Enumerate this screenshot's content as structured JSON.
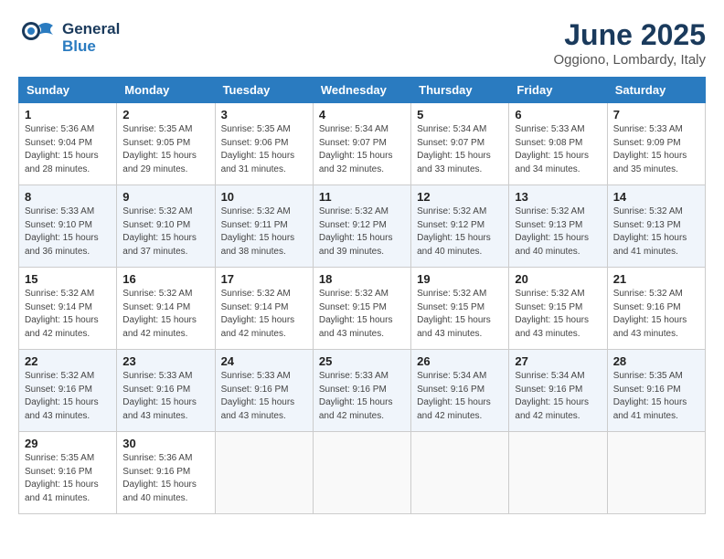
{
  "header": {
    "logo_general": "General",
    "logo_blue": "Blue",
    "title": "June 2025",
    "subtitle": "Oggiono, Lombardy, Italy"
  },
  "weekdays": [
    "Sunday",
    "Monday",
    "Tuesday",
    "Wednesday",
    "Thursday",
    "Friday",
    "Saturday"
  ],
  "weeks": [
    [
      {
        "day": "1",
        "info": "Sunrise: 5:36 AM\nSunset: 9:04 PM\nDaylight: 15 hours\nand 28 minutes."
      },
      {
        "day": "2",
        "info": "Sunrise: 5:35 AM\nSunset: 9:05 PM\nDaylight: 15 hours\nand 29 minutes."
      },
      {
        "day": "3",
        "info": "Sunrise: 5:35 AM\nSunset: 9:06 PM\nDaylight: 15 hours\nand 31 minutes."
      },
      {
        "day": "4",
        "info": "Sunrise: 5:34 AM\nSunset: 9:07 PM\nDaylight: 15 hours\nand 32 minutes."
      },
      {
        "day": "5",
        "info": "Sunrise: 5:34 AM\nSunset: 9:07 PM\nDaylight: 15 hours\nand 33 minutes."
      },
      {
        "day": "6",
        "info": "Sunrise: 5:33 AM\nSunset: 9:08 PM\nDaylight: 15 hours\nand 34 minutes."
      },
      {
        "day": "7",
        "info": "Sunrise: 5:33 AM\nSunset: 9:09 PM\nDaylight: 15 hours\nand 35 minutes."
      }
    ],
    [
      {
        "day": "8",
        "info": "Sunrise: 5:33 AM\nSunset: 9:10 PM\nDaylight: 15 hours\nand 36 minutes."
      },
      {
        "day": "9",
        "info": "Sunrise: 5:32 AM\nSunset: 9:10 PM\nDaylight: 15 hours\nand 37 minutes."
      },
      {
        "day": "10",
        "info": "Sunrise: 5:32 AM\nSunset: 9:11 PM\nDaylight: 15 hours\nand 38 minutes."
      },
      {
        "day": "11",
        "info": "Sunrise: 5:32 AM\nSunset: 9:12 PM\nDaylight: 15 hours\nand 39 minutes."
      },
      {
        "day": "12",
        "info": "Sunrise: 5:32 AM\nSunset: 9:12 PM\nDaylight: 15 hours\nand 40 minutes."
      },
      {
        "day": "13",
        "info": "Sunrise: 5:32 AM\nSunset: 9:13 PM\nDaylight: 15 hours\nand 40 minutes."
      },
      {
        "day": "14",
        "info": "Sunrise: 5:32 AM\nSunset: 9:13 PM\nDaylight: 15 hours\nand 41 minutes."
      }
    ],
    [
      {
        "day": "15",
        "info": "Sunrise: 5:32 AM\nSunset: 9:14 PM\nDaylight: 15 hours\nand 42 minutes."
      },
      {
        "day": "16",
        "info": "Sunrise: 5:32 AM\nSunset: 9:14 PM\nDaylight: 15 hours\nand 42 minutes."
      },
      {
        "day": "17",
        "info": "Sunrise: 5:32 AM\nSunset: 9:14 PM\nDaylight: 15 hours\nand 42 minutes."
      },
      {
        "day": "18",
        "info": "Sunrise: 5:32 AM\nSunset: 9:15 PM\nDaylight: 15 hours\nand 43 minutes."
      },
      {
        "day": "19",
        "info": "Sunrise: 5:32 AM\nSunset: 9:15 PM\nDaylight: 15 hours\nand 43 minutes."
      },
      {
        "day": "20",
        "info": "Sunrise: 5:32 AM\nSunset: 9:15 PM\nDaylight: 15 hours\nand 43 minutes."
      },
      {
        "day": "21",
        "info": "Sunrise: 5:32 AM\nSunset: 9:16 PM\nDaylight: 15 hours\nand 43 minutes."
      }
    ],
    [
      {
        "day": "22",
        "info": "Sunrise: 5:32 AM\nSunset: 9:16 PM\nDaylight: 15 hours\nand 43 minutes."
      },
      {
        "day": "23",
        "info": "Sunrise: 5:33 AM\nSunset: 9:16 PM\nDaylight: 15 hours\nand 43 minutes."
      },
      {
        "day": "24",
        "info": "Sunrise: 5:33 AM\nSunset: 9:16 PM\nDaylight: 15 hours\nand 43 minutes."
      },
      {
        "day": "25",
        "info": "Sunrise: 5:33 AM\nSunset: 9:16 PM\nDaylight: 15 hours\nand 42 minutes."
      },
      {
        "day": "26",
        "info": "Sunrise: 5:34 AM\nSunset: 9:16 PM\nDaylight: 15 hours\nand 42 minutes."
      },
      {
        "day": "27",
        "info": "Sunrise: 5:34 AM\nSunset: 9:16 PM\nDaylight: 15 hours\nand 42 minutes."
      },
      {
        "day": "28",
        "info": "Sunrise: 5:35 AM\nSunset: 9:16 PM\nDaylight: 15 hours\nand 41 minutes."
      }
    ],
    [
      {
        "day": "29",
        "info": "Sunrise: 5:35 AM\nSunset: 9:16 PM\nDaylight: 15 hours\nand 41 minutes."
      },
      {
        "day": "30",
        "info": "Sunrise: 5:36 AM\nSunset: 9:16 PM\nDaylight: 15 hours\nand 40 minutes."
      },
      {
        "day": "",
        "info": ""
      },
      {
        "day": "",
        "info": ""
      },
      {
        "day": "",
        "info": ""
      },
      {
        "day": "",
        "info": ""
      },
      {
        "day": "",
        "info": ""
      }
    ]
  ]
}
